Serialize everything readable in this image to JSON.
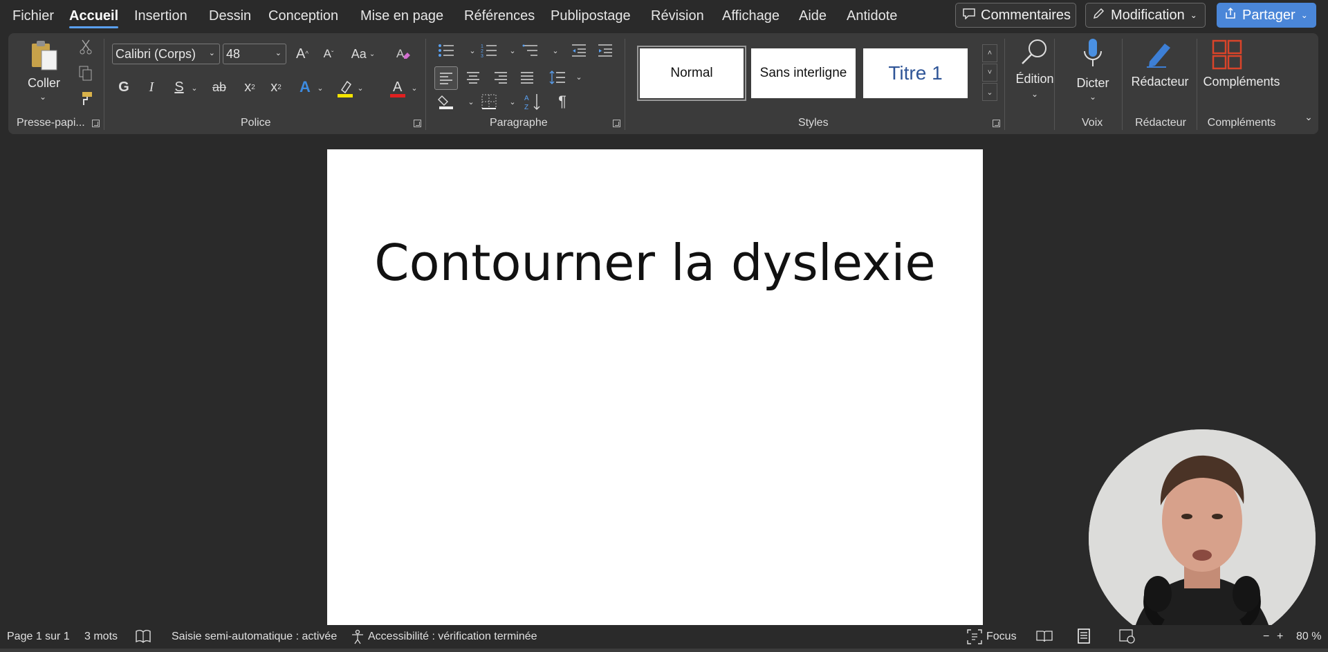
{
  "menu": {
    "tabs": [
      "Fichier",
      "Accueil",
      "Insertion",
      "Dessin",
      "Conception",
      "Mise en page",
      "Références",
      "Publipostage",
      "Révision",
      "Affichage",
      "Aide",
      "Antidote"
    ],
    "active": "Accueil",
    "comments_label": "Commentaires",
    "editing_label": "Modification",
    "share_label": "Partager"
  },
  "ribbon": {
    "clipboard": {
      "paste_label": "Coller",
      "group_label": "Presse-papi..."
    },
    "font": {
      "font_name": "Calibri (Corps)",
      "font_size": "48",
      "case_label": "Aa",
      "bold": "G",
      "italic": "I",
      "underline": "S",
      "strike": "ab",
      "group_label": "Police",
      "highlight_color": "#f5e400",
      "font_color": "#e02020"
    },
    "paragraph": {
      "group_label": "Paragraphe"
    },
    "styles": {
      "items": [
        "Normal",
        "Sans interligne",
        "Titre 1"
      ],
      "group_label": "Styles",
      "heading_color": "#2f5597"
    },
    "editing": {
      "label": "Édition"
    },
    "voice": {
      "label": "Dicter",
      "group_label": "Voix"
    },
    "editor": {
      "label": "Rédacteur",
      "group_label": "Rédacteur"
    },
    "addins": {
      "label": "Compléments",
      "group_label": "Compléments"
    }
  },
  "document": {
    "title": "Contourner la dyslexie"
  },
  "status": {
    "page": "Page 1 sur 1",
    "words": "3 mots",
    "autocomplete": "Saisie semi-automatique : activée",
    "accessibility": "Accessibilité : vérification terminée",
    "focus": "Focus",
    "zoom": "80 %"
  },
  "colors": {
    "accent": "#5aa0f0",
    "share": "#4a86d8"
  }
}
